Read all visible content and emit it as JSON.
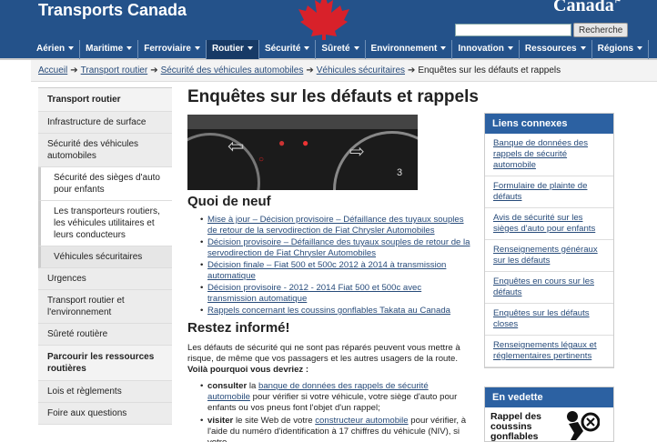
{
  "header": {
    "brand": "Transports Canada",
    "wordmark": "Canada",
    "search_placeholder": "",
    "search_button": "Recherche"
  },
  "nav": {
    "items": [
      {
        "label": "Aérien",
        "active": false
      },
      {
        "label": "Maritime",
        "active": false
      },
      {
        "label": "Ferroviaire",
        "active": false
      },
      {
        "label": "Routier",
        "active": true
      },
      {
        "label": "Sécurité",
        "active": false
      },
      {
        "label": "Sûreté",
        "active": false
      },
      {
        "label": "Environnement",
        "active": false
      },
      {
        "label": "Innovation",
        "active": false
      },
      {
        "label": "Ressources",
        "active": false
      },
      {
        "label": "Régions",
        "active": false
      }
    ]
  },
  "breadcrumb": {
    "items": [
      "Accueil",
      "Transport routier",
      "Sécurité des véhicules automobiles",
      "Véhicules sécuritaires"
    ],
    "current": "Enquêtes sur les défauts et rappels",
    "separator": "➔"
  },
  "sidebar": {
    "heading": "Transport routier",
    "items": [
      "Infrastructure de surface",
      "Sécurité des véhicules automobiles",
      "Sécurité des sièges d'auto pour enfants",
      "Les transporteurs routiers, les véhicules utilitaires et leurs conducteurs",
      "Véhicules sécuritaires",
      "Urgences",
      "Transport routier et l'environnement",
      "Sûreté routière"
    ],
    "heading2": "Parcourir les ressources routières",
    "items2": [
      "Lois et règlements",
      "Foire aux questions"
    ]
  },
  "main": {
    "title": "Enquêtes sur les défauts et rappels",
    "banner": {
      "number": "3"
    },
    "news_heading": "Quoi de neuf",
    "news": [
      "Mise à jour – Décision provisoire – Défaillance des tuyaux souples de retour de la servodirection de Fiat Chrysler Automobiles",
      "Décision provisoire – Défaillance des tuyaux souples de retour de la servodirection de Fiat Chrysler Automobiles",
      "Décision finale – Fiat 500 et 500c 2012 à 2014 à transmission automatique",
      "Décision provisoire - 2012 - 2014 Fiat 500 et 500c avec transmission automatique",
      "Rappels concernant les coussins gonflables Takata au Canada"
    ],
    "inform_heading": "Restez informé!",
    "inform_text": "Les défauts de sécurité qui ne sont pas réparés peuvent vous mettre à risque, de même que vos passagers et les autres usagers de la route.",
    "inform_bold": "Voilà pourquoi vous devriez :",
    "todo": [
      {
        "lead": "consulter",
        "pre": " la ",
        "link": "banque de données des rappels de sécurité automobile",
        "post": " pour vérifier si votre véhicule, votre siège d'auto pour enfants ou vos pneus font l'objet d'un rappel;"
      },
      {
        "lead": "visiter",
        "pre": " le site Web de votre ",
        "link": "constructeur automobile",
        "post": " pour vérifier, à l'aide du numéro d'identification à 17 chiffres du véhicule (NIV), si votre"
      }
    ]
  },
  "related": {
    "title": "Liens connexes",
    "links": [
      "Banque de données des rappels de sécurité automobile",
      "Formulaire de plainte de défauts",
      "Avis de sécurité sur les sièges d'auto pour enfants",
      "Renseignements généraux sur les défauts",
      "Enquêtes en cours sur les défauts",
      "Enquêtes sur les défauts closes",
      "Renseignements légaux et réglementaires pertinents"
    ]
  },
  "featured": {
    "title": "En vedette",
    "text": "Rappel des coussins gonflables TAKATA",
    "icon": "airbag-icon"
  },
  "colors": {
    "header_blue": "#24528a",
    "accent_blue": "#2c61a2",
    "link": "#274b7a",
    "leaf_red": "#d8212a"
  }
}
